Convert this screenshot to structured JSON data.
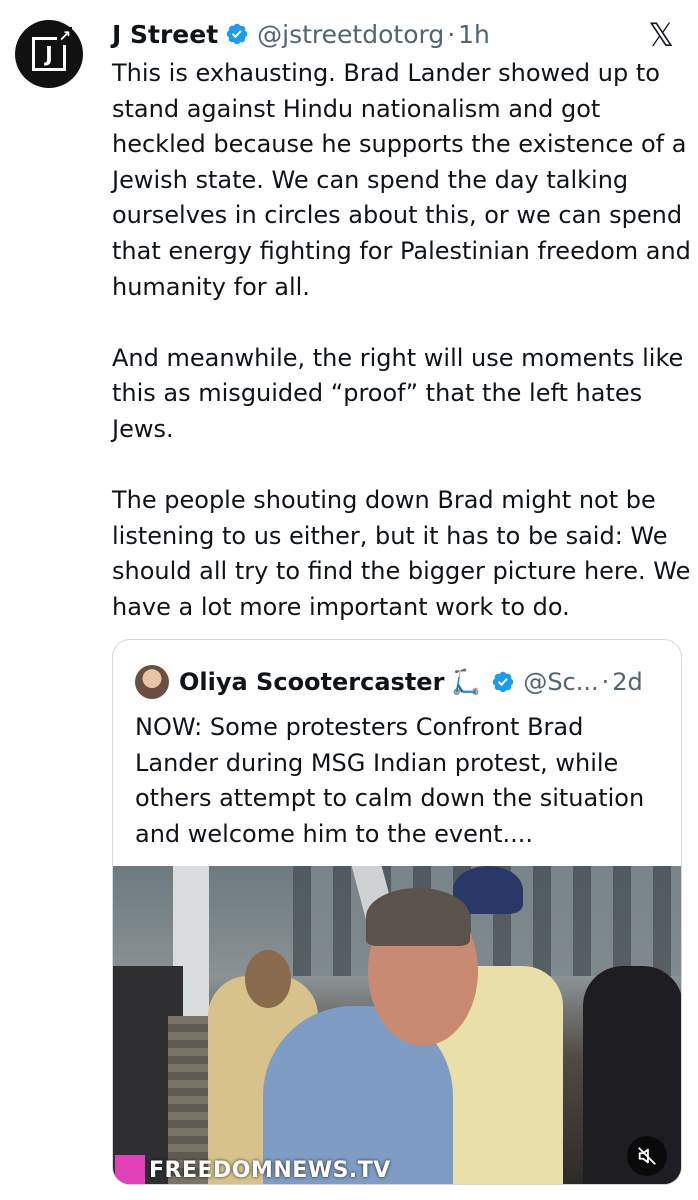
{
  "tweet": {
    "author_name": "J Street",
    "author_handle": "@jstreetdotorg",
    "separator": "·",
    "time": "1h",
    "avatar_letter": "J",
    "text": "This is exhausting. Brad Lander showed up to stand against Hindu nationalism and got heckled because he supports the existence of a Jewish state. We can spend the day talking ourselves in circles about this, or we can spend that energy fighting for Palestinian freedom and humanity for all.\n\nAnd meanwhile, the right will use moments like this as misguided “proof” that the left hates Jews.\n\nThe people shouting down Brad might not be listening to us either, but it has to be said: We should all try to find the bigger picture here. We have a lot more important work to do."
  },
  "quoted": {
    "author_name": "Oliya Scootercaster",
    "author_handle": "@Sc...",
    "separator": "·",
    "time": "2d",
    "text": "NOW: Some protesters Confront Brad Lander during MSG Indian protest, while others attempt to calm down the situation and welcome him to the event....",
    "media_watermark": "FREEDOMNEWS.TV"
  },
  "icons": {
    "verified": "verified-badge-icon",
    "platform": "x-logo-icon",
    "mute": "muted-speaker-icon",
    "scooter": "scooter-emoji"
  },
  "colors": {
    "verified": "#1d9bf0",
    "secondary_text": "#536471",
    "watermark_accent": "#e040b8"
  }
}
